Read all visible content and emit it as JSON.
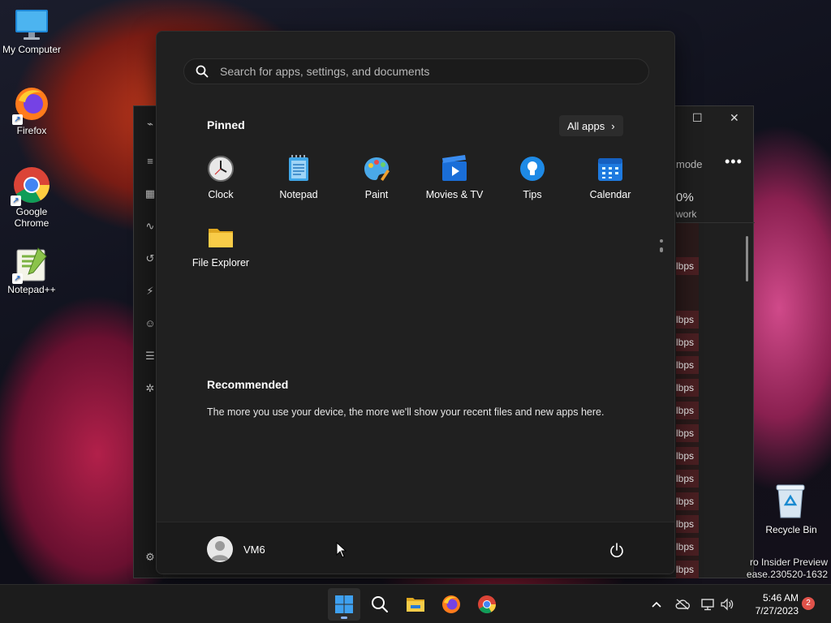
{
  "desktop": {
    "icons": [
      {
        "label": "My Computer"
      },
      {
        "label": "Firefox"
      },
      {
        "label": "Google Chrome"
      },
      {
        "label": "Notepad++"
      }
    ],
    "recycle_bin": "Recycle Bin",
    "watermark_line1": "ro Insider Preview",
    "watermark_line2": "ease.230520-1632"
  },
  "background_window": {
    "mode_label": "mode",
    "more_label": "•••",
    "percent": "0%",
    "column": "work",
    "cell_unit": "lbps",
    "maximize_glyph": "☐",
    "close_glyph": "✕"
  },
  "start_menu": {
    "search_placeholder": "Search for apps, settings, and documents",
    "pinned_title": "Pinned",
    "all_apps_label": "All apps",
    "pinned_apps": [
      {
        "label": "Clock",
        "icon": "clock-icon"
      },
      {
        "label": "Notepad",
        "icon": "notepad-icon"
      },
      {
        "label": "Paint",
        "icon": "paint-icon"
      },
      {
        "label": "Movies & TV",
        "icon": "movies-tv-icon"
      },
      {
        "label": "Tips",
        "icon": "tips-icon"
      },
      {
        "label": "Calendar",
        "icon": "calendar-icon"
      },
      {
        "label": "File Explorer",
        "icon": "file-explorer-icon"
      }
    ],
    "recommended_title": "Recommended",
    "recommended_text": "The more you use your device, the more we'll show your recent files and new apps here.",
    "user_name": "VM6"
  },
  "taskbar": {
    "time": "5:46 AM",
    "date": "7/27/2023",
    "notification_count": "2"
  }
}
